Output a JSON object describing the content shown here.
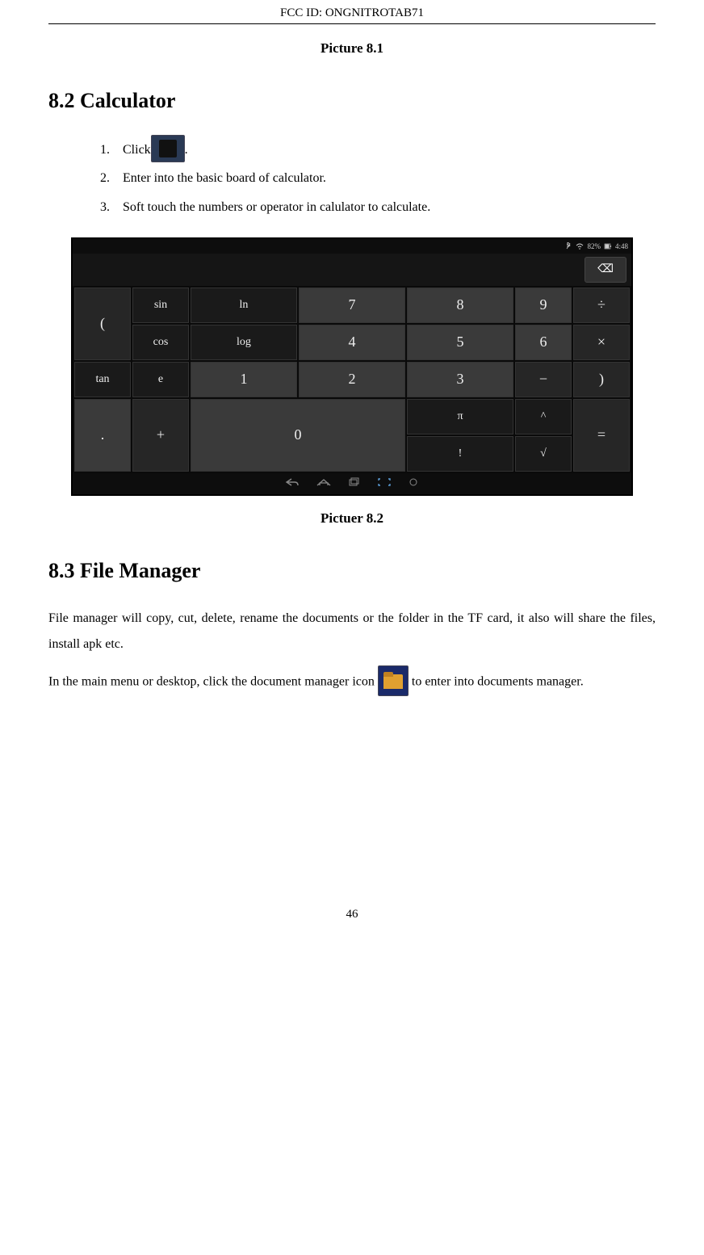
{
  "header": {
    "fcc": "FCC ID:  ONGNITROTAB71"
  },
  "captions": {
    "pic81": "Picture 8.1",
    "pic82": "Pictuer 8.2"
  },
  "sections": {
    "calc_heading": "8.2 Calculator",
    "fm_heading": "8.3 File Manager"
  },
  "steps": {
    "s1a": "Click",
    "s1b": ".",
    "s2": "Enter into the basic board of calculator.",
    "s3": "Soft touch the numbers or operator in calulator to calculate."
  },
  "screenshot": {
    "status": {
      "bt_icon": "bt",
      "wifi_icon": "wifi",
      "battery_text": "82%",
      "battery_icon": "batt",
      "time": "4:48"
    },
    "backspace": "⌫",
    "keys": {
      "fn": [
        [
          "sin",
          "ln"
        ],
        [
          "cos",
          "log"
        ],
        [
          "tan",
          "e"
        ],
        [
          "π",
          "^"
        ],
        [
          "!",
          "√"
        ]
      ],
      "num": [
        [
          "7",
          "8",
          "9"
        ],
        [
          "4",
          "5",
          "6"
        ],
        [
          "1",
          "2",
          "3"
        ]
      ],
      "zero": "0",
      "dot": ".",
      "plus": "+",
      "ops_right_col1": [
        "÷",
        "×",
        "−"
      ],
      "parens": [
        "(",
        ")"
      ],
      "eq": "="
    },
    "nav": {
      "back": "←",
      "home": "⌂",
      "recent": "▭",
      "screenshot": "[ ]",
      "vol": "▾"
    }
  },
  "fm": {
    "p1": "File manager will copy, cut, delete, rename the documents or the folder in the TF card, it also will share the files, install apk etc.",
    "p2a": "In the main menu or desktop, click the document manager icon ",
    "p2b": " to enter into documents manager."
  },
  "footer": {
    "page": "46"
  }
}
